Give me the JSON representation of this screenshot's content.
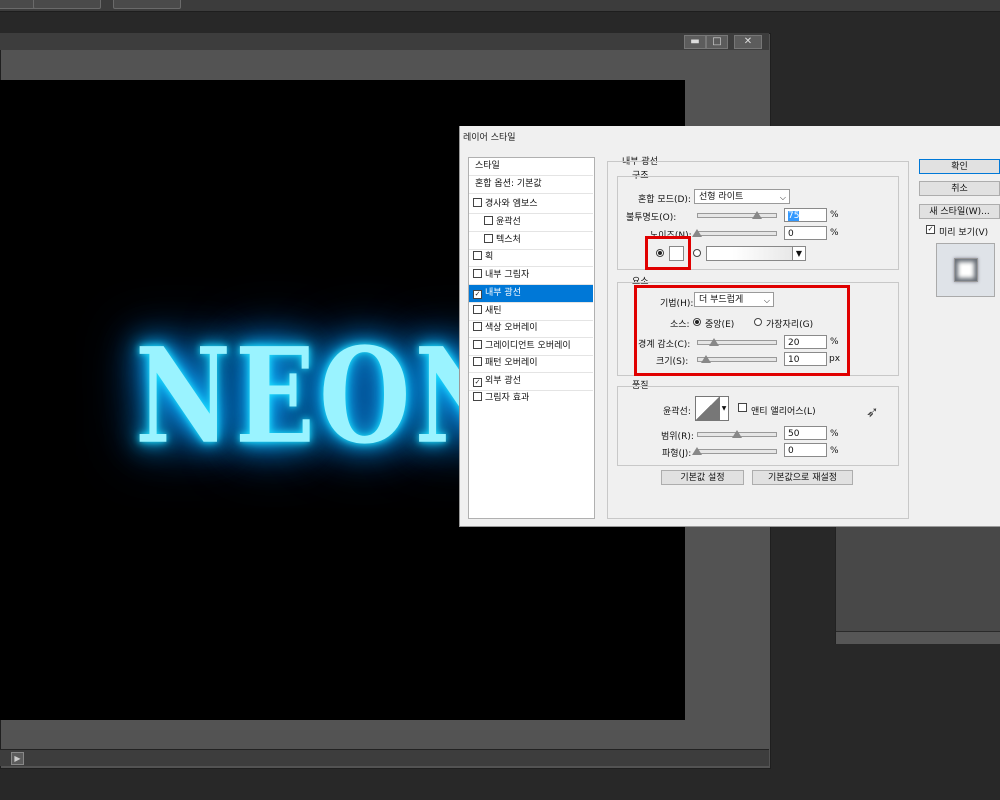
{
  "dialog": {
    "title": "레이어 스타일",
    "styles": [
      {
        "label": "스타일",
        "type": "header"
      },
      {
        "label": "혼합 옵션: 기본값",
        "type": "header"
      },
      {
        "label": "경사와 엠보스",
        "checked": false
      },
      {
        "label": "윤곽선",
        "checked": false,
        "indent": true
      },
      {
        "label": "텍스처",
        "checked": false,
        "indent": true
      },
      {
        "label": "획",
        "checked": false
      },
      {
        "label": "내부 그림자",
        "checked": false
      },
      {
        "label": "내부 광선",
        "checked": true,
        "selected": true
      },
      {
        "label": "새틴",
        "checked": false
      },
      {
        "label": "색상 오버레이",
        "checked": false
      },
      {
        "label": "그레이디언트 오버레이",
        "checked": false
      },
      {
        "label": "패턴 오버레이",
        "checked": false
      },
      {
        "label": "외부 광선",
        "checked": true
      },
      {
        "label": "그림자 효과",
        "checked": false
      }
    ],
    "section_title": "내부 광선",
    "structure": {
      "title": "구조",
      "blend_mode_label": "혼합 모드(D):",
      "blend_mode_value": "선형 라이트",
      "opacity_label": "불투명도(O):",
      "opacity_value": "75",
      "opacity_unit": "%",
      "noise_label": "노이즈(N):",
      "noise_value": "0",
      "noise_unit": "%"
    },
    "elements": {
      "title": "요소",
      "technique_label": "기법(H):",
      "technique_value": "더 부드럽게",
      "source_label": "소스:",
      "source_center": "중앙(E)",
      "source_edge": "가장자리(G)",
      "choke_label": "경계 감소(C):",
      "choke_value": "20",
      "choke_unit": "%",
      "size_label": "크기(S):",
      "size_value": "10",
      "size_unit": "px"
    },
    "quality": {
      "title": "품질",
      "contour_label": "윤곽선:",
      "antialias_label": "앤티 앨리어스(L)",
      "range_label": "범위(R):",
      "range_value": "50",
      "range_unit": "%",
      "jitter_label": "파형(J):",
      "jitter_value": "0",
      "jitter_unit": "%"
    },
    "default_set": "기본값 설정",
    "default_reset": "기본값으로 재설정",
    "ok": "확인",
    "cancel": "취소",
    "new_style": "새 스타일(W)...",
    "preview_label": "미리 보기(V)"
  },
  "canvas": {
    "text": "NEON",
    "glow_color": "#14c8ff",
    "text_color": "#9af3ff"
  },
  "window_buttons": {
    "minimize": "▬",
    "maximize": "□",
    "close": "✕"
  },
  "colors": {
    "highlight": "#0078d7",
    "annotation": "#e00000"
  }
}
